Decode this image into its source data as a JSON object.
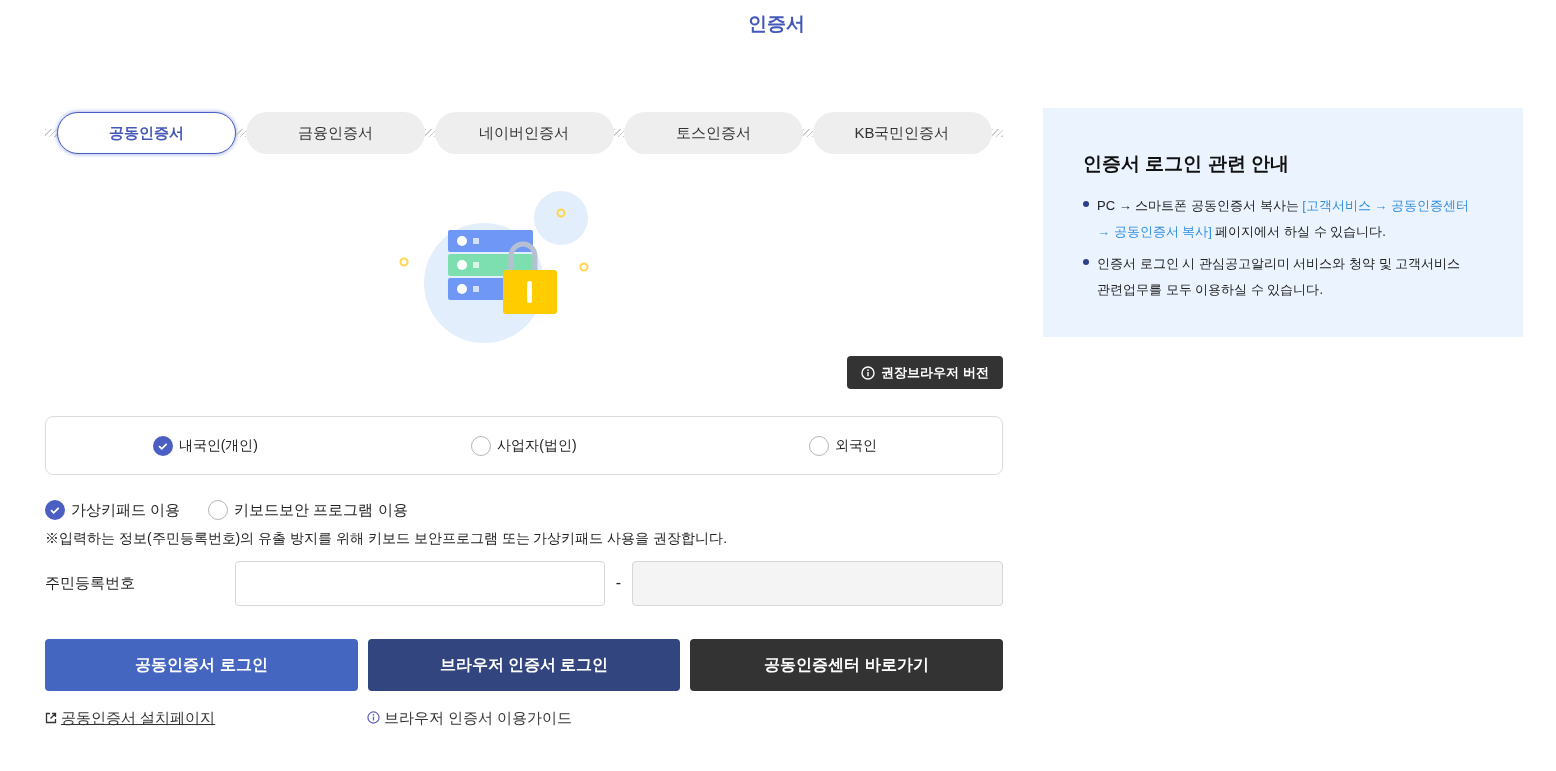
{
  "page_title": "인증서",
  "tabs": [
    {
      "label": "공동인증서",
      "selected": true
    },
    {
      "label": "금융인증서",
      "selected": false
    },
    {
      "label": "네이버인증서",
      "selected": false
    },
    {
      "label": "토스인증서",
      "selected": false
    },
    {
      "label": "KB국민인증서",
      "selected": false
    }
  ],
  "browser_version_button": "권장브라우저 버전",
  "user_types": [
    {
      "label": "내국인(개인)",
      "selected": true
    },
    {
      "label": "사업자(법인)",
      "selected": false
    },
    {
      "label": "외국인",
      "selected": false
    }
  ],
  "input_methods": [
    {
      "label": "가상키패드 이용",
      "selected": true
    },
    {
      "label": "키보드보안 프로그램 이용",
      "selected": false
    }
  ],
  "notice": "※입력하는 정보(주민등록번호)의 유출 방지를 위해 키보드 보안프로그램 또는 가상키패드 사용을 권장합니다.",
  "id_number": {
    "label": "주민등록번호",
    "separator": "-"
  },
  "buttons": [
    {
      "label": "공동인증서 로그인",
      "color": "#4466c0"
    },
    {
      "label": "브라우저 인증서 로그인",
      "color": "#33457e"
    },
    {
      "label": "공동인증센터 바로가기",
      "color": "#333333"
    }
  ],
  "links": [
    {
      "label": "공동인증서 설치페이지",
      "kind": "external"
    },
    {
      "label": "브라우저 인증서 이용가이드",
      "kind": "info"
    }
  ],
  "guide": {
    "title": "인증서 로그인 관련 안내",
    "items": [
      [
        {
          "text": "PC → 스마트폰 공동인증서 복사는 ",
          "kind": "plain"
        },
        {
          "text": "[고객서비스 → 공동인증센터",
          "kind": "link"
        },
        {
          "text": "→ 공동인증서 복사]",
          "kind": "link"
        },
        {
          "text": " 페이지에서 하실 수 있습니다.",
          "kind": "plain"
        }
      ],
      [
        {
          "text": "인증서 로그인 시 관심공고알리미 서비스와 청약 및 고객서비스 관련업무를 모두 이용하실 수 있습니다.",
          "kind": "plain"
        }
      ]
    ]
  }
}
